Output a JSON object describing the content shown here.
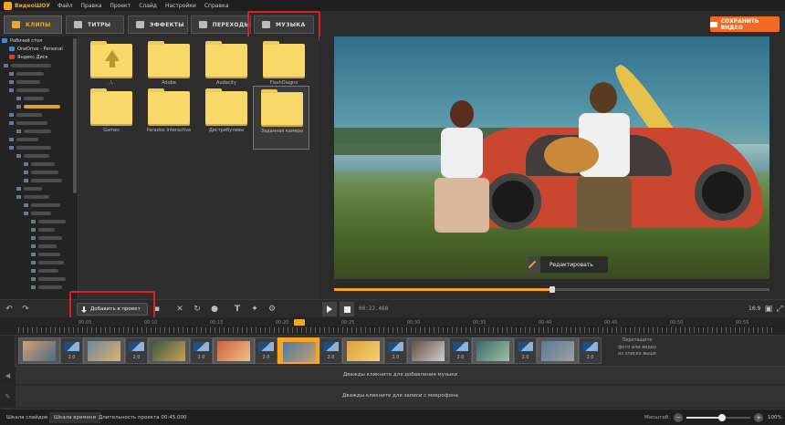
{
  "app": {
    "name": "ВидеоШОУ"
  },
  "menu": [
    "Файл",
    "Правка",
    "Проект",
    "Слайд",
    "Настройки",
    "Справка"
  ],
  "tabs": [
    {
      "label": "КЛИПЫ",
      "icon": "clips-icon"
    },
    {
      "label": "ТИТРЫ",
      "icon": "titles-icon"
    },
    {
      "label": "ЭФФЕКТЫ",
      "icon": "effects-icon"
    },
    {
      "label": "ПЕРЕХОДЫ",
      "icon": "transitions-icon"
    },
    {
      "label": "МУЗЫКА",
      "icon": "music-icon"
    }
  ],
  "active_tab": "КЛИПЫ",
  "save_button": "СОХРАНИТЬ ВИДЕО",
  "tree": {
    "items": [
      "Рабочий стол",
      "OneDrive - Personal",
      "Яндекс.Диск"
    ]
  },
  "folders": [
    {
      "label": "..\\..",
      "type": "up"
    },
    {
      "label": "Adobe"
    },
    {
      "label": "Audacity"
    },
    {
      "label": "FlashDiagno"
    },
    {
      "label": "Games"
    },
    {
      "label": "Paradox Interactive"
    },
    {
      "label": "Дистрибутивы"
    },
    {
      "label": "Заданная камера",
      "selected": true
    }
  ],
  "preview": {
    "edit_button": "Редактировать",
    "seek_progress": 0.5
  },
  "toolbar": {
    "add_to_project": "Добавить в проект",
    "timecode": "00:22.468",
    "aspect_ratio": "16:9"
  },
  "ruler": {
    "labels": [
      "00:05",
      "00:10",
      "00:15",
      "00:20",
      "00:25",
      "00:30",
      "00:35",
      "00:40",
      "00:45",
      "00:50",
      "00:55"
    ]
  },
  "timeline": {
    "transition_duration": "2.0",
    "drop_hint_lines": [
      "Перетащите",
      "фото или видео",
      "из списка выше"
    ],
    "music_hint": "Дважды кликните для добавления музыки",
    "mic_hint": "Дважды кликните для записи с микрофона"
  },
  "status": {
    "tab_slides": "Шкала слайдов",
    "tab_timeline": "Шкала времени",
    "duration": "Длительность проекта 00:45.000",
    "zoom_label": "Масштаб:",
    "zoom_value": "100%",
    "zoom_level": 0.55
  },
  "colors": {
    "accent": "#f5a623",
    "save": "#f26a22",
    "highlight": "#e02020"
  }
}
